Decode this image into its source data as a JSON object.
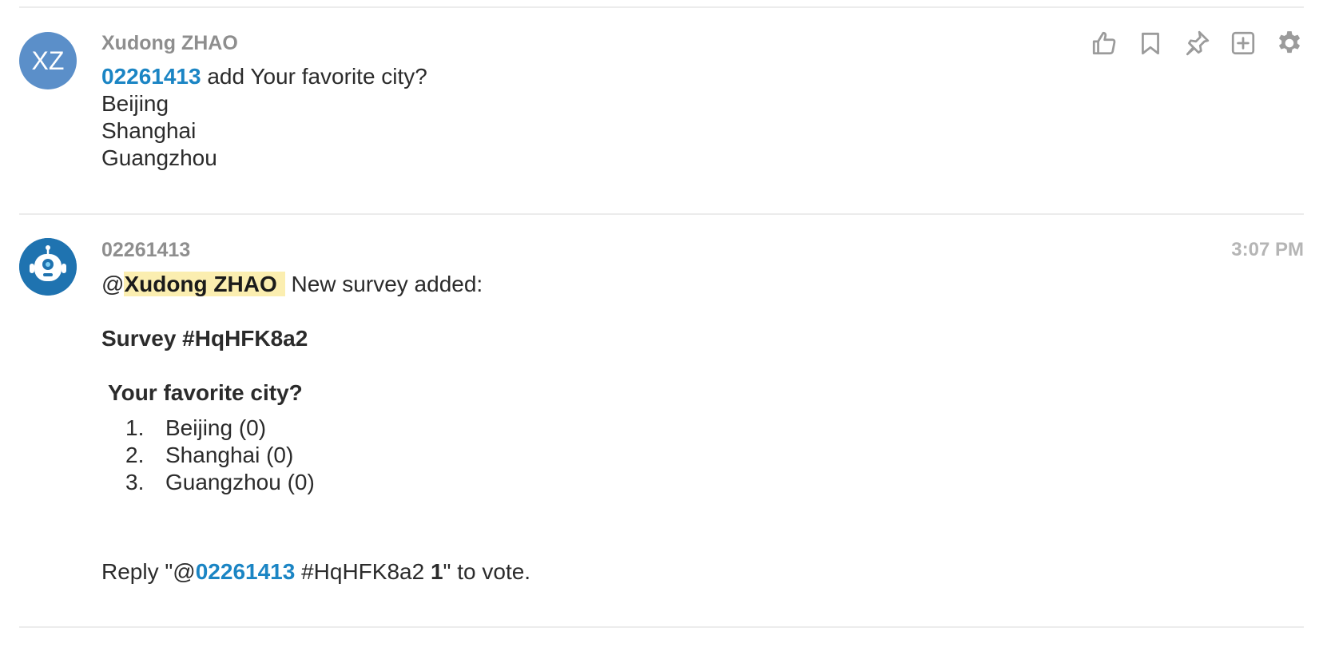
{
  "message1": {
    "avatar_initials": "XZ",
    "author": "Xudong ZHAO",
    "mention": "02261413",
    "command": " add Your favorite city?",
    "options": [
      "Beijing",
      "Shanghai",
      "Guangzhou"
    ],
    "actions": [
      "thumbs-up-icon",
      "bookmark-icon",
      "pin-icon",
      "add-icon",
      "gear-icon"
    ]
  },
  "message2": {
    "author": "02261413",
    "time": "3:07 PM",
    "at_sign": "@",
    "mentioned_user": "Xudong ZHAO",
    "intro": "New survey added:",
    "survey_title": "Survey #HqHFK8a2",
    "question": "Your favorite city?",
    "poll": [
      {
        "num": "1.",
        "label": "Beijing (0)"
      },
      {
        "num": "2.",
        "label": "Shanghai (0)"
      },
      {
        "num": "3.",
        "label": "Guangzhou (0)"
      }
    ],
    "reply": {
      "prefix": "Reply \"@",
      "mention": "02261413",
      "middle": " #HqHFK8a2 ",
      "vote_number": "1",
      "suffix": "\" to vote."
    }
  },
  "colors": {
    "accent": "#1b85c4",
    "highlight": "#fbeeb0",
    "avatar": "#5b8fc9",
    "bot_avatar": "#1f73b0"
  }
}
